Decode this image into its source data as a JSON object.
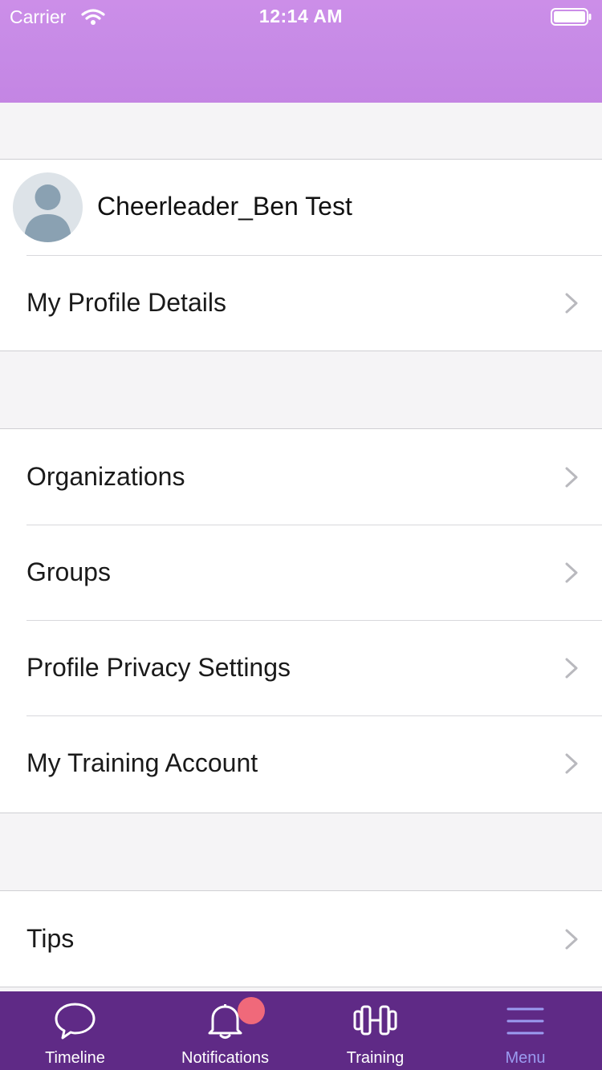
{
  "status_bar": {
    "carrier": "Carrier",
    "time": "12:14 AM"
  },
  "profile": {
    "name": "Cheerleader_Ben Test",
    "avatar_icon": "person-placeholder-icon"
  },
  "menu_sections": [
    {
      "items": [
        {
          "label": "My Profile Details"
        }
      ]
    },
    {
      "items": [
        {
          "label": "Organizations"
        },
        {
          "label": "Groups"
        },
        {
          "label": "Profile Privacy Settings"
        },
        {
          "label": "My Training Account"
        }
      ]
    },
    {
      "items": [
        {
          "label": "Tips"
        }
      ]
    }
  ],
  "tab_bar": {
    "tabs": [
      {
        "label": "Timeline",
        "icon": "speech-bubble-icon",
        "active": false
      },
      {
        "label": "Notifications",
        "icon": "bell-icon",
        "active": false,
        "has_badge": true
      },
      {
        "label": "Training",
        "icon": "dumbbell-icon",
        "active": false
      },
      {
        "label": "Menu",
        "icon": "hamburger-menu-icon",
        "active": true
      }
    ]
  },
  "colors": {
    "header_gradient": "#c98ae6",
    "tab_bar_bg": "#5f2a86",
    "tab_active": "#9b9bf0",
    "badge": "#f0697a",
    "background": "#f5f4f6"
  }
}
